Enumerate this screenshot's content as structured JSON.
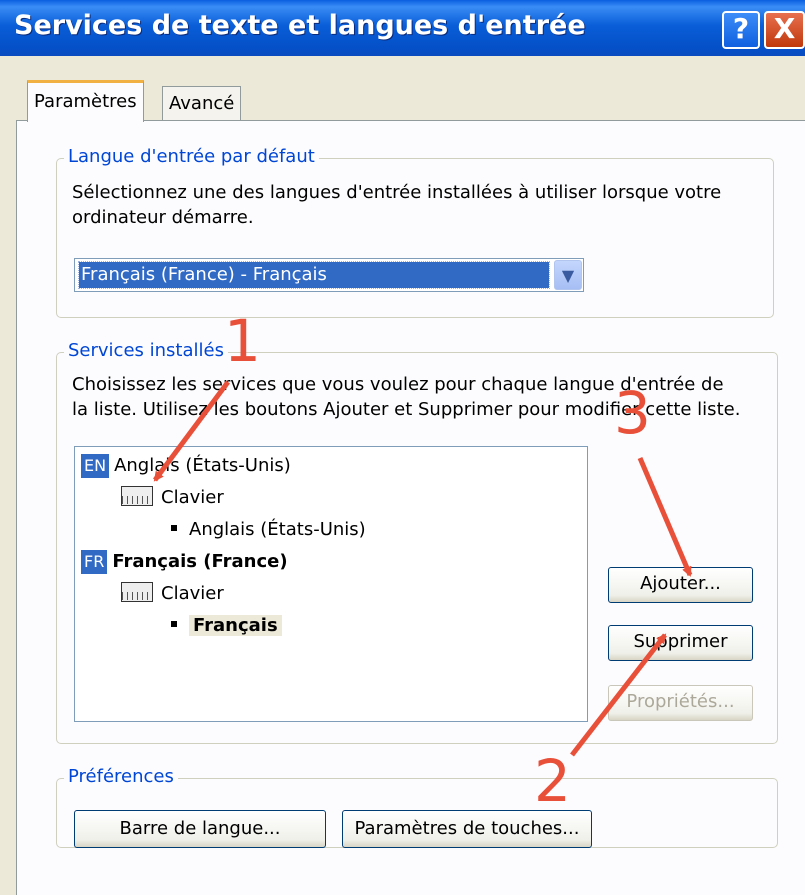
{
  "window": {
    "title": "Services de texte et langues d'entrée",
    "help_glyph": "?",
    "close_glyph": "X"
  },
  "tabs": [
    {
      "label": "Paramètres",
      "active": true
    },
    {
      "label": "Avancé",
      "active": false
    }
  ],
  "default_language": {
    "legend": "Langue d'entrée par défaut",
    "description_line1": "Sélectionnez une des langues d'entrée installées à utiliser lorsque votre",
    "description_line2": "ordinateur démarre.",
    "selected_value": "Français (France) - Français"
  },
  "installed_services": {
    "legend": "Services installés",
    "description_line1": "Choisissez les services que vous voulez pour chaque langue d'entrée de",
    "description_line2": "la liste. Utilisez les boutons Ajouter et Supprimer pour modifier cette liste.",
    "tree": [
      {
        "badge": "EN",
        "language": "Anglais (États-Unis)",
        "category": "Clavier",
        "layout": "Anglais (États-Unis)"
      },
      {
        "badge": "FR",
        "language": "Français (France)",
        "category": "Clavier",
        "layout": "Français"
      }
    ],
    "buttons": {
      "add": "Ajouter...",
      "remove": "Supprimer",
      "properties": "Propriétés..."
    }
  },
  "preferences": {
    "legend": "Préférences",
    "language_bar_button": "Barre de langue...",
    "key_settings_button": "Paramètres de touches..."
  },
  "annotations": {
    "marker_1": "1",
    "marker_2": "2",
    "marker_3": "3",
    "color": "#E8503A"
  },
  "colors": {
    "title_bar": "#0A5ED8",
    "selection": "#316AC5",
    "dialog_bg": "#ECE9D8",
    "link_blue": "#0046D5"
  }
}
